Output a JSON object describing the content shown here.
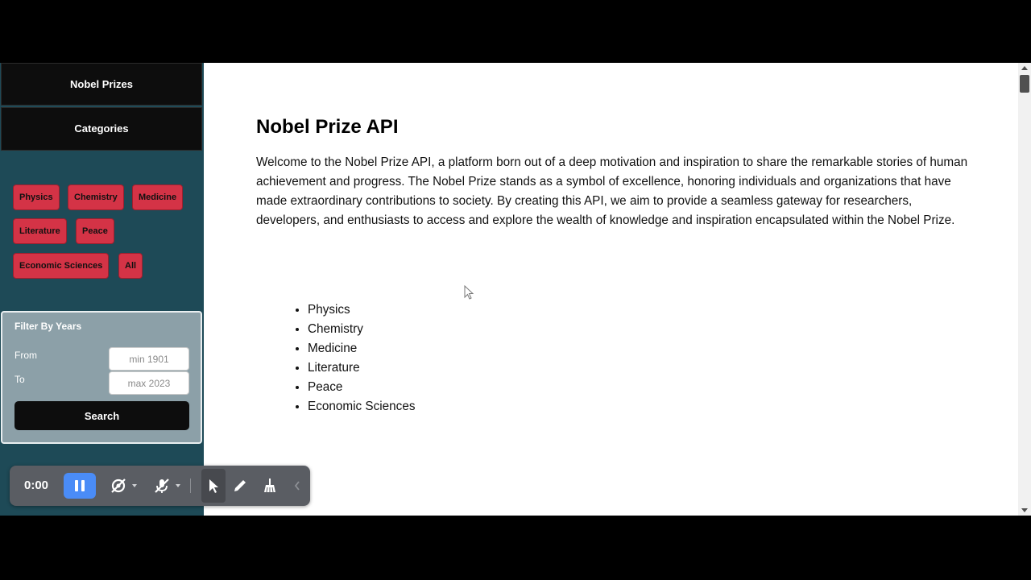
{
  "sidebar": {
    "nav": [
      {
        "label": "Nobel Prizes"
      },
      {
        "label": "Categories"
      }
    ],
    "chips": [
      {
        "label": "Physics"
      },
      {
        "label": "Chemistry"
      },
      {
        "label": "Medicine"
      },
      {
        "label": "Literature"
      },
      {
        "label": "Peace"
      },
      {
        "label": "Economic Sciences"
      },
      {
        "label": "All"
      }
    ],
    "filter": {
      "title": "Filter By Years",
      "from_label": "From",
      "to_label": "To",
      "from_placeholder": "min 1901",
      "to_placeholder": "max 2023",
      "search_label": "Search"
    }
  },
  "main": {
    "title": "Nobel Prize API",
    "intro": "Welcome to the Nobel Prize API, a platform born out of a deep motivation and inspiration to share the remarkable stories of human achievement and progress. The Nobel Prize stands as a symbol of excellence, honoring individuals and organizations that have made extraordinary contributions to society. By creating this API, we aim to provide a seamless gateway for researchers, developers, and enthusiasts to access and explore the wealth of knowledge and inspiration encapsulated within the Nobel Prize.",
    "categories": [
      "Physics",
      "Chemistry",
      "Medicine",
      "Literature",
      "Peace",
      "Economic Sciences"
    ]
  },
  "recorder": {
    "time": "0:00",
    "icons": [
      "pause-icon",
      "camera-off-icon",
      "mic-off-icon",
      "pointer-icon",
      "pencil-icon",
      "broom-icon",
      "chevron-left-icon"
    ]
  },
  "colors": {
    "sidebar_bg": "#1e4a57",
    "chip_bg": "#d43346",
    "nav_bg": "#0d0d0d",
    "filter_bg": "#8ca0a8",
    "recorder_accent": "#4a8cf7"
  }
}
